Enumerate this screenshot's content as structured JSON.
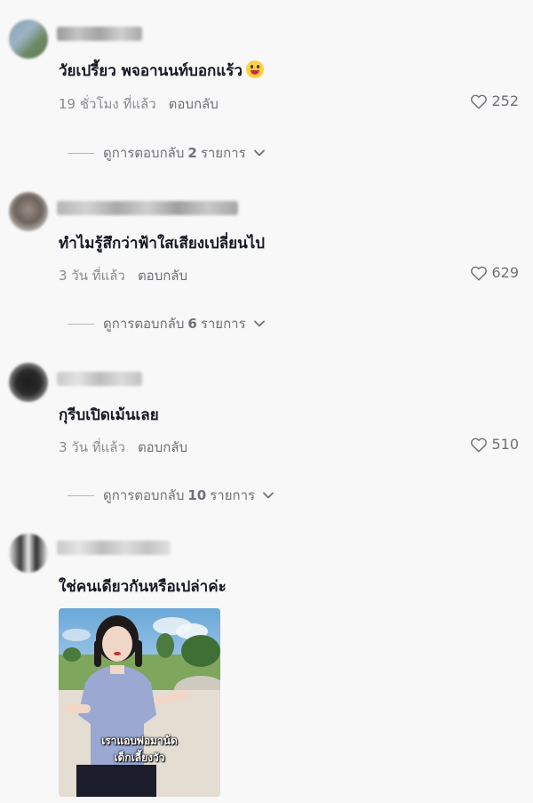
{
  "comments": [
    {
      "text": "วัยเปรี้ยว พจอานนท์บอกแร้ว",
      "emoji": "grinning-tongue-emoji",
      "time": "19 ชั่วโมง ที่แล้ว",
      "reply_label": "ตอบกลับ",
      "likes": "252",
      "replies_prefix": "ดูการตอบกลับ",
      "replies_count": "2",
      "replies_suffix": "รายการ"
    },
    {
      "text": "ทำไมรู้สึกว่าฟ้าใสเสียงเปลี่ยนไป",
      "time": "3 วัน ที่แล้ว",
      "reply_label": "ตอบกลับ",
      "likes": "629",
      "replies_prefix": "ดูการตอบกลับ",
      "replies_count": "6",
      "replies_suffix": "รายการ"
    },
    {
      "text": "กุรีบเปิดเม้นเลย",
      "time": "3 วัน ที่แล้ว",
      "reply_label": "ตอบกลับ",
      "likes": "510",
      "replies_prefix": "ดูการตอบกลับ",
      "replies_count": "10",
      "replies_suffix": "รายการ"
    },
    {
      "text": "ใช่คนเดียวกันหรือเปล่าค่ะ",
      "video_caption_line1": "เราแอบพ่อมาน้ด",
      "video_caption_line2": "เด็กเลี้ยงวัว"
    }
  ],
  "icons": {
    "like": "heart-outline-icon",
    "expand": "chevron-down-icon"
  },
  "colors": {
    "background": "#f8f8f8",
    "text_primary": "#161823",
    "text_secondary": "#8a8b91"
  }
}
